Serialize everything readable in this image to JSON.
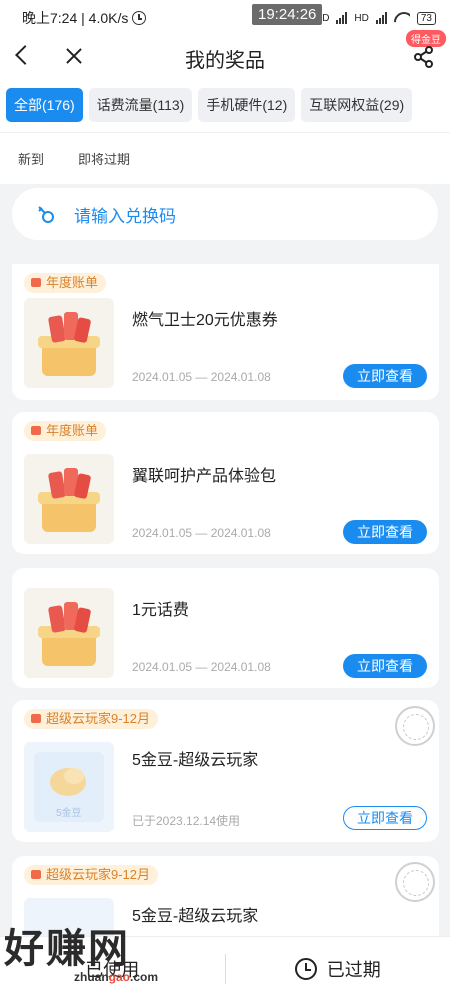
{
  "status_bar": {
    "left_text": "晚上7:24 | 4.0K/s",
    "time_overlay": "19:24:26",
    "battery": "73"
  },
  "header": {
    "title": "我的奖品",
    "share_badge": "得金豆"
  },
  "tabs": [
    {
      "label": "全部(176)",
      "active": true
    },
    {
      "label": "话费流量(113)",
      "active": false
    },
    {
      "label": "手机硬件(12)",
      "active": false
    },
    {
      "label": "互联网权益(29)",
      "active": false
    }
  ],
  "filters": [
    "新到",
    "即将过期"
  ],
  "redeem": {
    "placeholder": "请输入兑换码"
  },
  "cards": [
    {
      "badge": "年度账单",
      "name": "燃气卫士20元优惠券",
      "date": "2024.01.05 — 2024.01.08",
      "button": "立即查看"
    },
    {
      "badge": "年度账单",
      "name": "翼联呵护产品体验包",
      "date": "2024.01.05 — 2024.01.08",
      "button": "立即查看"
    },
    {
      "badge": "",
      "name": "1元话费",
      "date": "2024.01.05 — 2024.01.08",
      "button": "立即查看"
    },
    {
      "badge": "超级云玩家9-12月",
      "name": "5金豆-超级云玩家",
      "date": "已于2023.12.14使用",
      "button": "立即查看",
      "thumb_text": "5金豆"
    },
    {
      "badge": "超级云玩家9-12月",
      "name": "5金豆-超级云玩家",
      "date": "",
      "button": ""
    }
  ],
  "bottom_bar": {
    "used": "已使用",
    "expired": "已过期"
  },
  "watermark": {
    "main": "好赚网",
    "sub_prefix": "zhuan",
    "sub_highlight": "gao",
    "sub_suffix": ".com"
  },
  "colors": {
    "accent": "#1a8cf0",
    "badge_bg": "#fff0d9",
    "badge_text": "#d9822b"
  }
}
